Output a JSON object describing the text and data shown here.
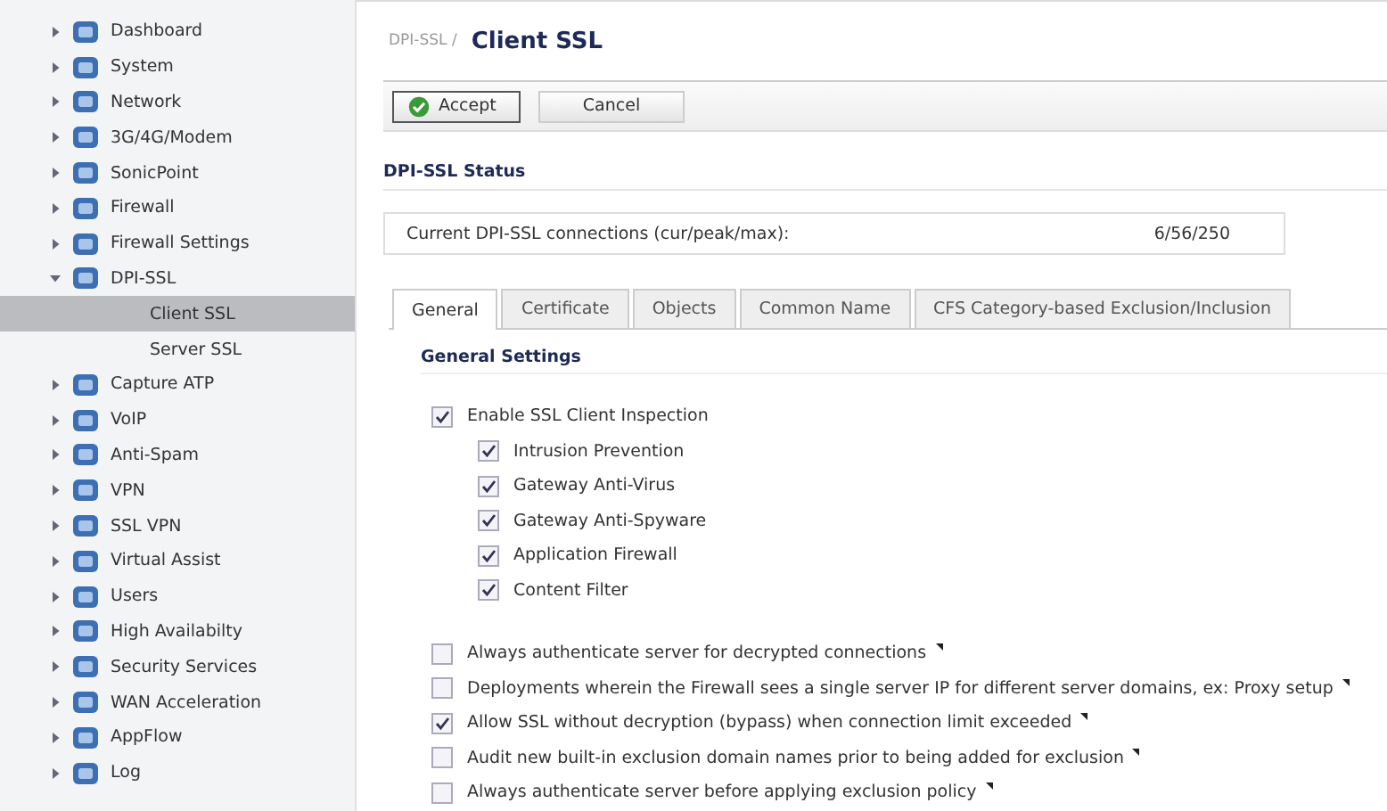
{
  "sidebar": {
    "items": [
      {
        "label": "Dashboard",
        "expanded": false,
        "selected": false
      },
      {
        "label": "System",
        "expanded": false,
        "selected": false
      },
      {
        "label": "Network",
        "expanded": false,
        "selected": false
      },
      {
        "label": "3G/4G/Modem",
        "expanded": false,
        "selected": false
      },
      {
        "label": "SonicPoint",
        "expanded": false,
        "selected": false
      },
      {
        "label": "Firewall",
        "expanded": false,
        "selected": false
      },
      {
        "label": "Firewall Settings",
        "expanded": false,
        "selected": false
      },
      {
        "label": "DPI-SSL",
        "expanded": true,
        "selected": false,
        "children": [
          {
            "label": "Client SSL",
            "selected": true
          },
          {
            "label": "Server SSL",
            "selected": false
          }
        ]
      },
      {
        "label": "Capture ATP",
        "expanded": false,
        "selected": false
      },
      {
        "label": "VoIP",
        "expanded": false,
        "selected": false
      },
      {
        "label": "Anti-Spam",
        "expanded": false,
        "selected": false
      },
      {
        "label": "VPN",
        "expanded": false,
        "selected": false
      },
      {
        "label": "SSL VPN",
        "expanded": false,
        "selected": false
      },
      {
        "label": "Virtual Assist",
        "expanded": false,
        "selected": false
      },
      {
        "label": "Users",
        "expanded": false,
        "selected": false
      },
      {
        "label": "High Availabilty",
        "expanded": false,
        "selected": false
      },
      {
        "label": "Security Services",
        "expanded": false,
        "selected": false
      },
      {
        "label": "WAN Acceleration",
        "expanded": false,
        "selected": false
      },
      {
        "label": "AppFlow",
        "expanded": false,
        "selected": false
      },
      {
        "label": "Log",
        "expanded": false,
        "selected": false
      }
    ]
  },
  "breadcrumb": "DPI-SSL /",
  "title": "Client SSL",
  "buttons": [
    {
      "label": "Accept",
      "kind": "primary"
    },
    {
      "label": "Cancel",
      "kind": "plain"
    }
  ],
  "status": {
    "heading": "DPI-SSL Status",
    "label": "Current DPI-SSL connections (cur/peak/max):",
    "value": "6/56/250"
  },
  "tabs": [
    {
      "label": "General",
      "selected": true
    },
    {
      "label": "Certificate",
      "selected": false
    },
    {
      "label": "Objects",
      "selected": false
    },
    {
      "label": "Common Name",
      "selected": false
    },
    {
      "label": "CFS Category-based Exclusion/Inclusion",
      "selected": false
    }
  ],
  "settings": {
    "heading": "General Settings",
    "options": [
      {
        "label": "Enable SSL Client Inspection",
        "checked": true,
        "children": [
          {
            "label": "Intrusion Prevention",
            "checked": true
          },
          {
            "label": "Gateway Anti-Virus",
            "checked": true
          },
          {
            "label": "Gateway Anti-Spyware",
            "checked": true
          },
          {
            "label": "Application Firewall",
            "checked": true
          },
          {
            "label": "Content Filter",
            "checked": true
          }
        ]
      }
    ],
    "advanced": [
      {
        "label": "Always authenticate server for decrypted connections",
        "checked": false,
        "note": true
      },
      {
        "label": "Deployments wherein the Firewall sees a single server IP for different server domains, ex: Proxy setup",
        "checked": false,
        "note": true
      },
      {
        "label": "Allow SSL without decryption (bypass) when connection limit exceeded",
        "checked": true,
        "note": true
      },
      {
        "label": "Audit new built-in exclusion domain names prior to being added for exclusion",
        "checked": false,
        "note": true
      },
      {
        "label": "Always authenticate server before applying exclusion policy",
        "checked": false,
        "note": true
      }
    ]
  }
}
